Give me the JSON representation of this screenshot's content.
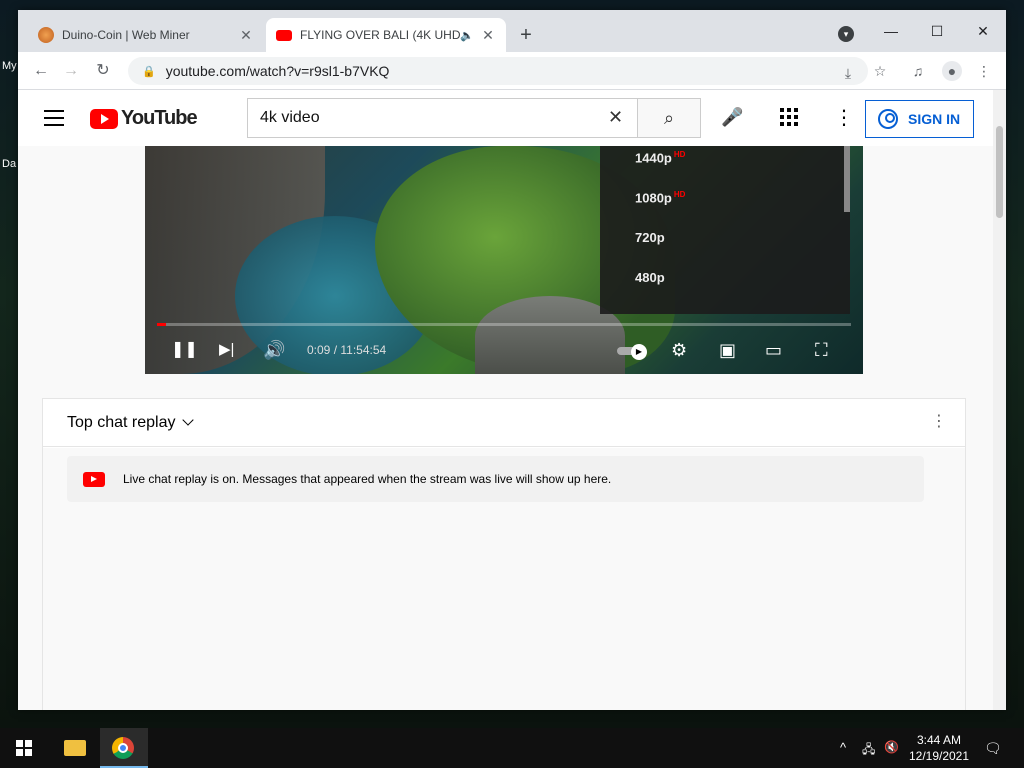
{
  "desktop": {
    "label_1": "My",
    "label_2": "Da"
  },
  "browser": {
    "tabs": [
      {
        "title": "Duino-Coin | Web Miner",
        "close": "✕"
      },
      {
        "title": "FLYING OVER BALI (4K UHD)",
        "audio": "🔈",
        "close": "✕"
      }
    ],
    "new_tab": "+",
    "window_controls": {
      "minimize": "—",
      "maximize": "☐",
      "close": "✕"
    },
    "toolbar": {
      "back": "←",
      "forward": "→",
      "reload": "↻",
      "url": "youtube.com/watch?v=r9sl1-b7VKQ",
      "lock": "🔒",
      "install_icon": "⤓",
      "star_icon": "☆",
      "media_icon": "♫",
      "profile_icon": "●",
      "menu_icon": "⋮"
    }
  },
  "youtube": {
    "logo_text": "YouTube",
    "search": {
      "value": "4k video",
      "clear": "✕",
      "button": "⌕"
    },
    "mic": "🎤",
    "kebab": "⋮",
    "sign_in": "SIGN IN"
  },
  "player": {
    "quality_options": [
      {
        "label": "1440p",
        "badge": "HD"
      },
      {
        "label": "1080p",
        "badge": "HD"
      },
      {
        "label": "720p",
        "badge": ""
      },
      {
        "label": "480p",
        "badge": ""
      }
    ],
    "progress_fraction": 0.013,
    "time": "0:09 / 11:54:54",
    "controls": {
      "pause": "❚❚",
      "next": "▶|",
      "volume": "🔊",
      "settings": "⚙",
      "miniplayer": "▣",
      "theater": "▭",
      "fullscreen": "⛶"
    }
  },
  "chat": {
    "title": "Top chat replay",
    "kebab": "⋮",
    "banner_message": "Live chat replay is on. Messages that appeared when the stream was live will show up here."
  },
  "taskbar": {
    "tray_chevron": "^",
    "network": "🖧",
    "volume_muted": "🔇",
    "notification": "🗨",
    "time": "3:44 AM",
    "date": "12/19/2021"
  },
  "colors": {
    "accent_blue": "#065fd4",
    "youtube_red": "#ff0000"
  }
}
